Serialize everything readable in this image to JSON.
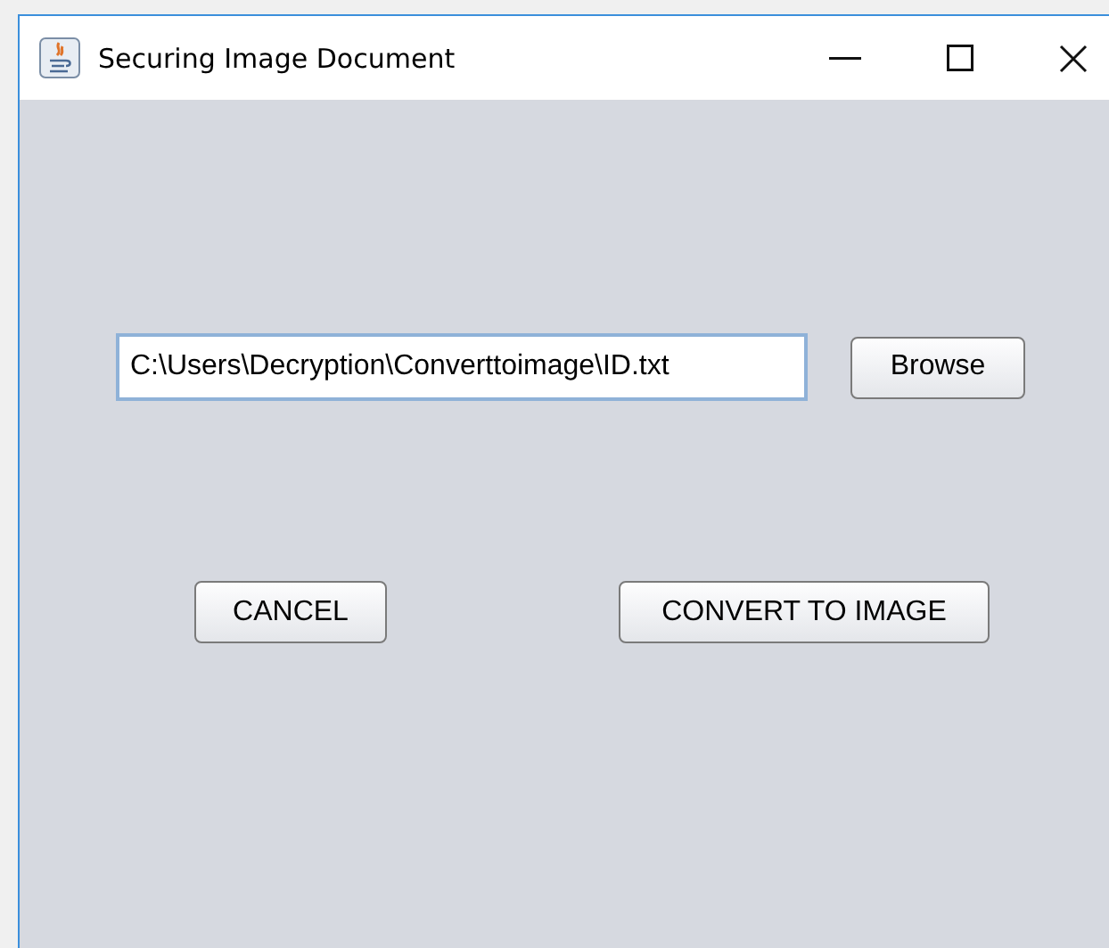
{
  "window": {
    "title": "Securing Image Document"
  },
  "file_field": {
    "value": "C:\\Users\\Decryption\\Converttoimage\\ID.txt"
  },
  "browse_button": "Browse",
  "buttons": [
    {
      "label": "CANCEL",
      "kind": "cancel"
    },
    {
      "label": "CONVERT TO IMAGE",
      "kind": "convert"
    }
  ]
}
